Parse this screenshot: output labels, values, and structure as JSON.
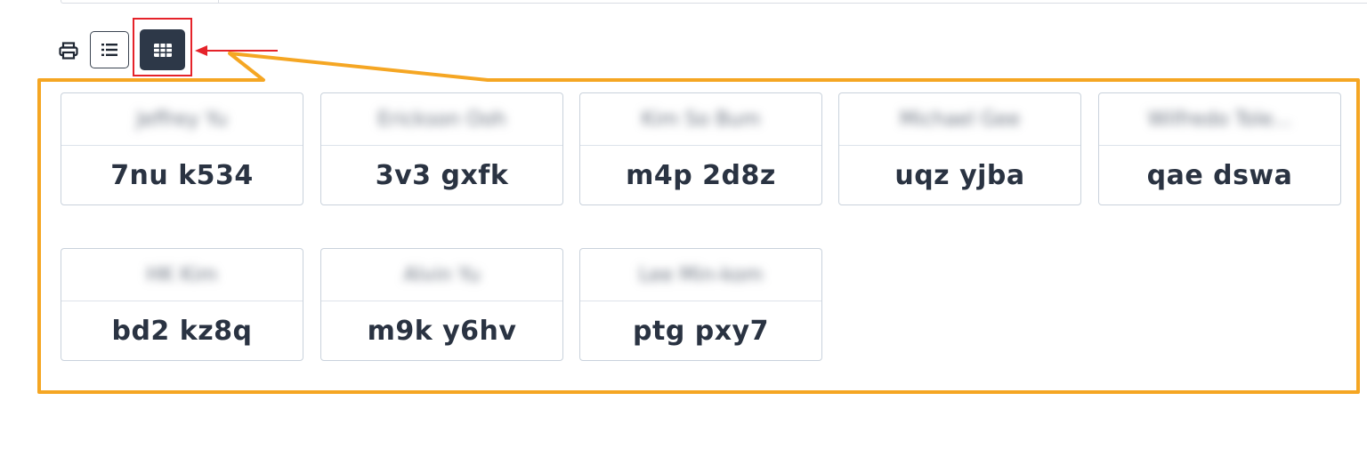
{
  "toolbar": {
    "print_icon": "printer-icon",
    "list_view_icon": "list-icon",
    "grid_view_icon": "grid-icon",
    "active_view": "grid"
  },
  "annotations": {
    "highlight_color": "#e5232a",
    "callout_color": "#f5a623"
  },
  "cards": [
    {
      "name": "Jeffrey Yu",
      "code": "7nu k534"
    },
    {
      "name": "Erickson Ooh",
      "code": "3v3 gxfk"
    },
    {
      "name": "Kim So Bum",
      "code": "m4p 2d8z"
    },
    {
      "name": "Michael Gee",
      "code": "uqz yjba"
    },
    {
      "name": "Wilfredo Tole...",
      "code": "qae dswa"
    },
    {
      "name": "HK Kim",
      "code": "bd2 kz8q"
    },
    {
      "name": "Alvin Yu",
      "code": "m9k y6hv"
    },
    {
      "name": "Lee Min-kom",
      "code": "ptg pxy7"
    }
  ]
}
